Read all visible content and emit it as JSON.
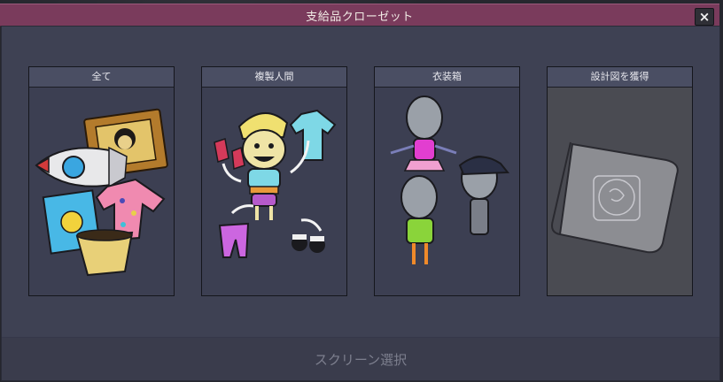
{
  "window": {
    "title": "支給品クローゼット",
    "close_icon": "×"
  },
  "categories": [
    {
      "label": "全て",
      "art": "assorted-items-illustration"
    },
    {
      "label": "複製人間",
      "art": "duplicant-outfit-illustration"
    },
    {
      "label": "衣装箱",
      "art": "outfit-mannequins-illustration"
    },
    {
      "label": "設計図を獲得",
      "art": "blueprint-scroll-illustration"
    }
  ],
  "footer": {
    "label": "スクリーン選択"
  },
  "colors": {
    "titlebar": "#7a3b5c",
    "panel": "#3e4153",
    "card_header": "#4a4e63"
  }
}
